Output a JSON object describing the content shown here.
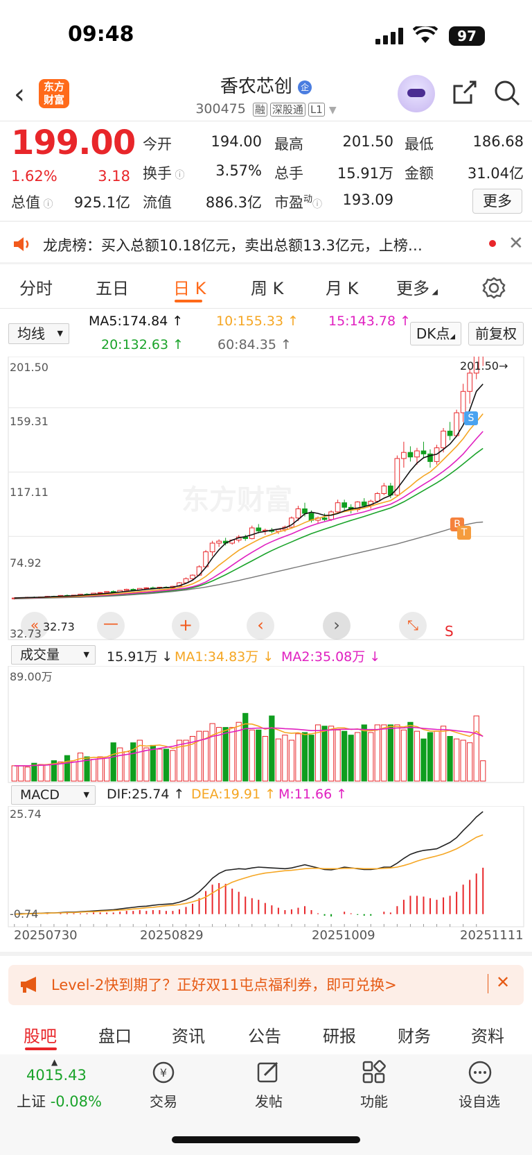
{
  "status": {
    "time": "09:48",
    "battery": "97"
  },
  "nav": {
    "logo_line1": "东方",
    "logo_line2": "财富",
    "stock_name": "香农芯创",
    "code": "300475",
    "tags": [
      "融",
      "深股通",
      "L1"
    ]
  },
  "quote": {
    "price": "199.00",
    "change_pct": "1.62%",
    "change": "3.18",
    "open_label": "今开",
    "open": "194.00",
    "high_label": "最高",
    "high": "201.50",
    "low_label": "最低",
    "low": "186.68",
    "turnover_label": "换手",
    "turnover": "3.57%",
    "volume_label": "总手",
    "volume": "15.91万",
    "amount_label": "金额",
    "amount": "31.04亿",
    "mcap_label": "总值",
    "mcap": "925.1亿",
    "float_label": "流值",
    "float_val": "886.3亿",
    "pe_label": "市盈",
    "pe_sup": "动",
    "pe": "193.09",
    "more": "更多"
  },
  "notice": {
    "text": "龙虎榜：买入总额10.18亿元，卖出总额13.3亿元，上榜…"
  },
  "tabs": [
    "分时",
    "五日",
    "日 K",
    "周 K",
    "月 K",
    "更多"
  ],
  "ma": {
    "select": "均线",
    "ma5": "MA5:174.84 ↑",
    "ma10": "10:155.33 ↑",
    "ma15": "15:143.78 ↑",
    "ma20": "20:132.63 ↑",
    "ma60": "60:84.35 ↑",
    "dk": "DK点",
    "fq": "前复权",
    "colors": {
      "ma5": "#111111",
      "ma10": "#f5a623",
      "ma15": "#e020c0",
      "ma20": "#1aa32a",
      "ma60": "#777777"
    }
  },
  "kchart": {
    "y_labels": [
      "201.50",
      "159.31",
      "117.11",
      "74.92",
      "32.73"
    ],
    "high_marker": "201.50→",
    "low_marker": "32.73",
    "watermark": "东方财富",
    "sig_s": "S",
    "sig_b": "B",
    "sig_t": "T",
    "sig_s2": "S"
  },
  "volume": {
    "select": "成交量",
    "vol": "15.91万 ↓",
    "ma1": "MA1:34.83万 ↓",
    "ma2": "MA2:35.08万 ↓",
    "max_label": "89.00万"
  },
  "macd": {
    "select": "MACD",
    "dif": "DIF:25.74 ↑",
    "dea": "DEA:19.91 ↑",
    "m": "M:11.66 ↑",
    "max_label": "25.74",
    "min_label": "-0.74",
    "dates": [
      "20250730",
      "20250829",
      "20251009",
      "20251111"
    ]
  },
  "chart_data": {
    "type": "candlestick",
    "title": "",
    "ylim": [
      32.73,
      201.5
    ],
    "candles": [
      [
        34,
        35,
        33.5,
        34.5
      ],
      [
        34.5,
        35,
        34,
        34.8
      ],
      [
        34.8,
        35.3,
        34.5,
        35
      ],
      [
        35,
        35.5,
        34.6,
        34.9
      ],
      [
        34.9,
        35.4,
        34.5,
        35.2
      ],
      [
        35.2,
        35.8,
        35,
        35.6
      ],
      [
        35.6,
        36,
        35.2,
        35.5
      ],
      [
        35.5,
        36.4,
        35.3,
        36.2
      ],
      [
        36.2,
        36.8,
        35.8,
        36.1
      ],
      [
        36.1,
        36.6,
        35.7,
        36.4
      ],
      [
        36.4,
        37.2,
        36.1,
        37
      ],
      [
        37,
        37.6,
        36.5,
        36.8
      ],
      [
        36.8,
        37.9,
        36.6,
        37.7
      ],
      [
        37.7,
        38.4,
        37.2,
        38.1
      ],
      [
        38.1,
        39,
        37.8,
        38.8
      ],
      [
        38.8,
        39.5,
        38,
        38.4
      ],
      [
        38.4,
        39.7,
        38.2,
        39.5
      ],
      [
        39.5,
        40.6,
        39,
        40.2
      ],
      [
        40.2,
        40.8,
        39.4,
        39.9
      ],
      [
        39.9,
        41,
        39.6,
        40.8
      ],
      [
        40.8,
        41.5,
        40,
        41.2
      ],
      [
        41.2,
        42,
        40.6,
        40.9
      ],
      [
        40.9,
        41.8,
        40.5,
        41.6
      ],
      [
        41.6,
        42.2,
        40.9,
        41.3
      ],
      [
        41.3,
        42.5,
        41,
        42.2
      ],
      [
        42.2,
        45,
        42,
        44.5
      ],
      [
        44.5,
        48,
        44,
        47.2
      ],
      [
        47.2,
        50,
        46.5,
        49.5
      ],
      [
        49.5,
        56,
        49,
        55
      ],
      [
        55,
        66,
        54,
        64.8
      ],
      [
        64.8,
        72,
        62,
        70.5
      ],
      [
        70.5,
        73,
        68,
        71.8
      ],
      [
        71.8,
        74,
        69,
        70.5
      ],
      [
        70.5,
        73,
        69.5,
        72.5
      ],
      [
        72.5,
        75.8,
        71,
        74.5
      ],
      [
        74.5,
        76,
        72,
        73.5
      ],
      [
        73.5,
        82,
        73,
        80.5
      ],
      [
        80.5,
        83,
        77,
        78.5
      ],
      [
        78.5,
        80,
        76,
        79
      ],
      [
        79,
        80.5,
        77,
        78.2
      ],
      [
        78.2,
        80,
        76.5,
        79.5
      ],
      [
        79.5,
        82,
        78,
        81
      ],
      [
        81,
        88,
        80,
        87
      ],
      [
        87,
        95,
        85,
        93
      ],
      [
        93,
        97,
        88,
        90
      ],
      [
        90,
        92,
        84,
        85.5
      ],
      [
        85.5,
        88,
        83,
        87
      ],
      [
        87,
        90,
        85,
        86
      ],
      [
        86,
        92,
        85,
        91
      ],
      [
        91,
        99,
        90,
        97
      ],
      [
        97,
        99,
        92,
        94
      ],
      [
        94,
        96,
        90,
        92.5
      ],
      [
        92.5,
        98,
        91,
        97.5
      ],
      [
        97.5,
        100,
        94,
        95
      ],
      [
        95,
        99,
        93,
        98
      ],
      [
        98,
        104,
        97,
        103
      ],
      [
        103,
        110,
        102,
        108
      ],
      [
        108,
        110,
        100,
        102
      ],
      [
        102,
        128,
        101,
        126
      ],
      [
        126,
        137,
        120,
        130
      ],
      [
        130,
        134,
        124,
        127
      ],
      [
        127,
        133,
        122,
        131
      ],
      [
        131,
        137,
        126,
        129
      ],
      [
        129,
        132,
        120,
        124
      ],
      [
        124,
        135,
        122,
        133
      ],
      [
        133,
        146,
        130,
        144
      ],
      [
        144,
        150,
        138,
        141
      ],
      [
        141,
        158,
        140,
        156
      ],
      [
        156,
        175,
        150,
        170
      ],
      [
        170,
        185,
        162,
        182
      ],
      [
        182,
        201.5,
        178,
        198
      ],
      [
        194,
        201.5,
        186.68,
        199
      ]
    ],
    "ma5": [
      34.5,
      34.7,
      34.8,
      34.9,
      35,
      35.2,
      35.4,
      35.6,
      35.8,
      36,
      36.3,
      36.6,
      36.9,
      37.2,
      37.6,
      38,
      38.4,
      38.9,
      39.3,
      39.7,
      40.2,
      40.6,
      41,
      41.3,
      41.6,
      42.6,
      44.1,
      46.2,
      49.6,
      54.6,
      60.8,
      66.1,
      70.5,
      72.5,
      74,
      74.8,
      76,
      77.5,
      78.2,
      79,
      79.7,
      80.5,
      82.5,
      86,
      89.7,
      90.8,
      90,
      88.7,
      88.8,
      89.9,
      91.7,
      93,
      93.5,
      94.4,
      95.7,
      97.5,
      100,
      101.8,
      106.3,
      112,
      118,
      123,
      126.5,
      127.9,
      128.8,
      132,
      135.5,
      140.7,
      148,
      158,
      170,
      174.84
    ],
    "ma10": [
      34.5,
      34.6,
      34.7,
      34.8,
      34.9,
      35,
      35.1,
      35.3,
      35.5,
      35.6,
      35.8,
      36,
      36.3,
      36.6,
      36.8,
      37.2,
      37.5,
      37.9,
      38.3,
      38.7,
      39.1,
      39.5,
      39.9,
      40.3,
      40.7,
      41.4,
      42.4,
      43.8,
      45.9,
      48.7,
      52.3,
      56,
      59.3,
      62.6,
      65.8,
      68.2,
      70.6,
      72.8,
      74.7,
      76.2,
      77.8,
      79,
      80.3,
      82,
      84,
      85.7,
      86.8,
      88,
      89,
      90.2,
      91.2,
      92,
      92.8,
      93.5,
      94.8,
      96.1,
      97.3,
      98.4,
      101.2,
      104.5,
      107.8,
      111.5,
      114.6,
      117.2,
      121,
      125.3,
      129.6,
      134,
      139,
      145,
      150,
      155.33
    ],
    "ma15": [
      34.5,
      34.6,
      34.6,
      34.7,
      34.8,
      34.9,
      35,
      35.1,
      35.3,
      35.4,
      35.6,
      35.7,
      35.9,
      36.2,
      36.4,
      36.7,
      37,
      37.3,
      37.6,
      38,
      38.3,
      38.7,
      39.1,
      39.5,
      39.9,
      40.4,
      41,
      41.9,
      43.2,
      45,
      47.5,
      50.3,
      53,
      56,
      59,
      61.8,
      64.5,
      67,
      69.5,
      71.5,
      73.3,
      75,
      76.6,
      78.5,
      80.3,
      82,
      83.4,
      84.6,
      85.7,
      86.9,
      88,
      89,
      90,
      91,
      92.3,
      93.6,
      94.8,
      96,
      98.2,
      100.7,
      103.5,
      106.3,
      109,
      111.6,
      114.5,
      117.6,
      121,
      124.8,
      129,
      134,
      139,
      143.78
    ],
    "ma20": [
      34.5,
      34.5,
      34.6,
      34.7,
      34.8,
      34.8,
      34.9,
      35,
      35.1,
      35.3,
      35.4,
      35.6,
      35.8,
      36,
      36.2,
      36.4,
      36.7,
      37,
      37.3,
      37.6,
      37.9,
      38.2,
      38.6,
      39,
      39.4,
      39.9,
      40.5,
      41.3,
      42.4,
      43.9,
      45.7,
      47.7,
      49.8,
      52,
      54.3,
      56.6,
      58.9,
      61.2,
      63.5,
      65.6,
      67.6,
      69.5,
      71.3,
      73.2,
      75,
      76.7,
      78.2,
      79.7,
      81.1,
      82.6,
      84,
      85.4,
      86.7,
      88,
      89.4,
      90.8,
      92.2,
      93.6,
      95.5,
      97.6,
      100,
      102.5,
      105,
      107.5,
      110,
      112.8,
      115.8,
      119,
      122.5,
      126,
      129.5,
      132.63
    ],
    "ma60": [
      34,
      34.1,
      34.2,
      34.3,
      34.4,
      34.5,
      34.6,
      34.7,
      34.8,
      34.9,
      35,
      35.2,
      35.3,
      35.5,
      35.7,
      35.9,
      36.1,
      36.4,
      36.7,
      37,
      37.3,
      37.6,
      38,
      38.4,
      38.8,
      39.3,
      39.8,
      40.4,
      41,
      41.7,
      42.5,
      43.3,
      44.2,
      45.1,
      46,
      47,
      48,
      49,
      50,
      51,
      52,
      53,
      54,
      55,
      56,
      57,
      58,
      59,
      60,
      61,
      62,
      63,
      64,
      65,
      66,
      67,
      68,
      69,
      70,
      71.2,
      72.4,
      73.6,
      74.8,
      76,
      77.2,
      78.5,
      79.8,
      81,
      82.2,
      83.2,
      84,
      84.35
    ],
    "volume": [
      12,
      12,
      11,
      14,
      13,
      13,
      16,
      15,
      20,
      15,
      22,
      19,
      17,
      19,
      18,
      30,
      26,
      23,
      30,
      32,
      26,
      28,
      25,
      25,
      24,
      32,
      32,
      35,
      39,
      39,
      45,
      42,
      42,
      42,
      46,
      53,
      40,
      40,
      35,
      51,
      33,
      36,
      32,
      37,
      38,
      36,
      44,
      43,
      43,
      40,
      39,
      36,
      38,
      44,
      38,
      44,
      44,
      44,
      44,
      40,
      46,
      39,
      33,
      38,
      39,
      43,
      35,
      33,
      32,
      30,
      51,
      15.91
    ],
    "vol_ma1": [
      12,
      12,
      12,
      12.4,
      12.6,
      13,
      13.6,
      14,
      15.4,
      16,
      17.6,
      18,
      18.6,
      18.4,
      19,
      21,
      22.2,
      23,
      24.6,
      28,
      27.4,
      27.8,
      28.2,
      27.2,
      25.6,
      26.8,
      27.6,
      29,
      31.6,
      33.4,
      36,
      38,
      39.6,
      41.4,
      43,
      44.8,
      44.6,
      43,
      40.6,
      41.8,
      40,
      38,
      37.4,
      37.8,
      36.4,
      37,
      38,
      39.2,
      40.6,
      41.6,
      41.6,
      40.4,
      40.8,
      39.4,
      39.4,
      40,
      41.6,
      42.8,
      42.6,
      42.4,
      43.6,
      42.6,
      40.4,
      39.2,
      39,
      39,
      39.6,
      38,
      36.4,
      35,
      39,
      34.83
    ],
    "vol_ma2": [
      12,
      12,
      12,
      12.2,
      12.4,
      12.6,
      13,
      13.5,
      14.2,
      14.8,
      15.5,
      16.2,
      17,
      17.5,
      18,
      19,
      20,
      20.8,
      21.6,
      22.8,
      24,
      24.8,
      25.6,
      26.5,
      27.2,
      28.5,
      29.5,
      30.5,
      31.8,
      33,
      35,
      36,
      37.5,
      38.5,
      39.5,
      41,
      41.2,
      41.5,
      41.3,
      41.5,
      41.4,
      41,
      40.8,
      40.5,
      40,
      39.5,
      39.5,
      39.8,
      40,
      40.4,
      40.6,
      40.6,
      40.6,
      40.4,
      40.3,
      40.4,
      40.8,
      41.2,
      41.5,
      41.6,
      42,
      41.8,
      41.2,
      40.8,
      40.4,
      40.3,
      40,
      39.4,
      38.8,
      38.2,
      37.2,
      35.08
    ],
    "macd_dif": [
      0,
      0.1,
      0.1,
      0.2,
      0.2,
      0.3,
      0.3,
      0.4,
      0.5,
      0.5,
      0.6,
      0.7,
      0.8,
      0.9,
      1,
      1.1,
      1.3,
      1.5,
      1.7,
      1.9,
      2,
      2.2,
      2.4,
      2.5,
      2.6,
      3,
      3.6,
      4.4,
      5.6,
      7.2,
      9,
      10.2,
      11,
      11.2,
      11.4,
      11.3,
      11.6,
      11.8,
      11.7,
      11.6,
      11.5,
      11.4,
      11.6,
      12,
      12.4,
      12,
      11.6,
      11.2,
      11.1,
      11.4,
      11.8,
      11.6,
      11.4,
      11.2,
      11.2,
      11.4,
      11.8,
      11.8,
      12.8,
      14,
      15,
      15.6,
      16,
      16.2,
      16.4,
      17.2,
      18,
      19.2,
      21,
      22.6,
      24.4,
      25.74
    ],
    "macd_dea": [
      0,
      0,
      0.1,
      0.1,
      0.2,
      0.2,
      0.3,
      0.3,
      0.4,
      0.4,
      0.5,
      0.6,
      0.6,
      0.7,
      0.8,
      0.9,
      1,
      1.1,
      1.3,
      1.4,
      1.6,
      1.7,
      1.9,
      2.1,
      2.2,
      2.4,
      2.7,
      3.1,
      3.6,
      4.3,
      5.3,
      6.3,
      7.2,
      8,
      8.6,
      9.1,
      9.6,
      10,
      10.3,
      10.5,
      10.7,
      10.9,
      11,
      11.2,
      11.4,
      11.5,
      11.5,
      11.4,
      11.4,
      11.4,
      11.5,
      11.5,
      11.5,
      11.4,
      11.4,
      11.4,
      11.5,
      11.6,
      11.8,
      12.2,
      12.7,
      13.3,
      13.8,
      14.2,
      14.6,
      15.1,
      15.7,
      16.4,
      17.3,
      18.3,
      19.3,
      19.91
    ],
    "macd_hist": [
      0,
      0.2,
      0,
      0.2,
      0,
      0.2,
      0,
      0.2,
      0.2,
      0.2,
      0.2,
      0.2,
      0.4,
      0.4,
      0.4,
      0.4,
      0.6,
      0.8,
      0.8,
      1,
      0.8,
      1,
      1,
      0.8,
      0.8,
      1.2,
      1.8,
      2.6,
      4,
      5.8,
      7.4,
      7.8,
      7.6,
      6.4,
      5.6,
      4.4,
      4,
      3.6,
      2.8,
      2.2,
      1.6,
      1,
      1.2,
      1.6,
      2,
      1,
      0.2,
      -0.4,
      -0.6,
      0,
      0.6,
      0.2,
      -0.2,
      -0.4,
      -0.4,
      0,
      0.6,
      0.4,
      2,
      3.6,
      4.6,
      4.6,
      4.4,
      4,
      3.6,
      4.2,
      4.6,
      5.6,
      7.4,
      8.6,
      10.2,
      11.66
    ]
  },
  "banner": {
    "text": "Level-2快到期了？正好双11屯点福利券，即可兑换>"
  },
  "bottom_tabs": [
    "股吧",
    "盘口",
    "资讯",
    "公告",
    "研报",
    "财务",
    "资料"
  ],
  "dock": {
    "index_value": "4015.43",
    "index_label": "上证",
    "index_change": "-0.08%",
    "trade": "交易",
    "post": "发帖",
    "func": "功能",
    "watch": "设自选"
  }
}
